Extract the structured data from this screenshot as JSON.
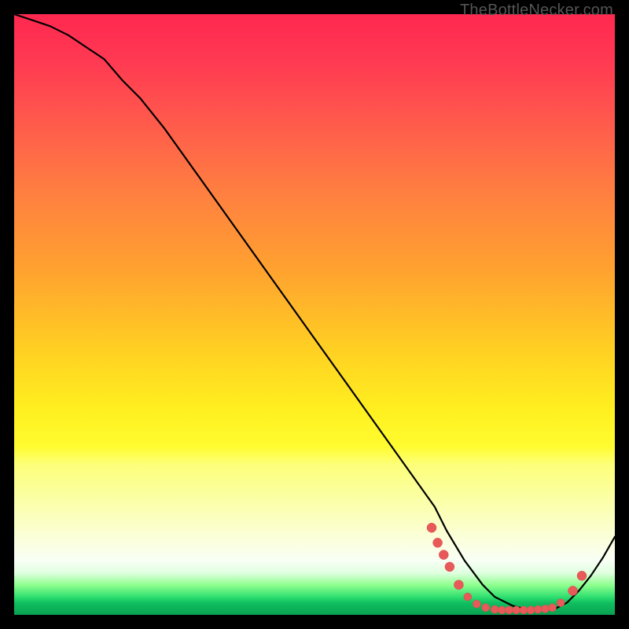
{
  "watermark": {
    "text": "TheBottleNecker.com"
  },
  "colors": {
    "curve": "#000000",
    "marker_fill": "#e85a5a",
    "marker_stroke": "#d84848"
  },
  "chart_data": {
    "type": "line",
    "title": "",
    "xlabel": "",
    "ylabel": "",
    "xlim": [
      0,
      100
    ],
    "ylim": [
      0,
      100
    ],
    "grid": false,
    "series": [
      {
        "name": "curve",
        "x": [
          0,
          3,
          6,
          9,
          12,
          15,
          18,
          21,
          25,
          30,
          35,
          40,
          45,
          50,
          55,
          60,
          65,
          70,
          72,
          75,
          78,
          80,
          83,
          85,
          88,
          90,
          92,
          94,
          96,
          98,
          100
        ],
        "y": [
          100,
          99,
          98,
          96.5,
          94.5,
          92.5,
          89,
          86,
          81,
          74,
          67,
          60,
          53,
          46,
          39,
          32,
          25,
          18,
          14,
          9,
          5,
          3,
          1.5,
          1,
          0.8,
          1,
          2,
          4,
          6.5,
          9.5,
          13
        ]
      }
    ],
    "markers": [
      {
        "x": 69.5,
        "y": 14.5,
        "r": 1.2
      },
      {
        "x": 70.5,
        "y": 12.0,
        "r": 1.2
      },
      {
        "x": 71.5,
        "y": 10.0,
        "r": 1.2
      },
      {
        "x": 72.5,
        "y": 8.0,
        "r": 1.2
      },
      {
        "x": 74.0,
        "y": 5.0,
        "r": 1.2
      },
      {
        "x": 75.5,
        "y": 3.0,
        "r": 1.0
      },
      {
        "x": 77.0,
        "y": 1.8,
        "r": 1.0
      },
      {
        "x": 78.5,
        "y": 1.2,
        "r": 1.0
      },
      {
        "x": 80.0,
        "y": 0.9,
        "r": 1.0
      },
      {
        "x": 81.2,
        "y": 0.8,
        "r": 1.0
      },
      {
        "x": 82.4,
        "y": 0.8,
        "r": 1.0
      },
      {
        "x": 83.6,
        "y": 0.8,
        "r": 1.0
      },
      {
        "x": 84.8,
        "y": 0.8,
        "r": 1.0
      },
      {
        "x": 86.0,
        "y": 0.8,
        "r": 1.0
      },
      {
        "x": 87.2,
        "y": 0.9,
        "r": 1.0
      },
      {
        "x": 88.4,
        "y": 1.0,
        "r": 1.0
      },
      {
        "x": 89.6,
        "y": 1.2,
        "r": 1.0
      },
      {
        "x": 91.0,
        "y": 2.0,
        "r": 1.0
      },
      {
        "x": 93.0,
        "y": 4.0,
        "r": 1.2
      },
      {
        "x": 94.5,
        "y": 6.5,
        "r": 1.2
      }
    ]
  }
}
